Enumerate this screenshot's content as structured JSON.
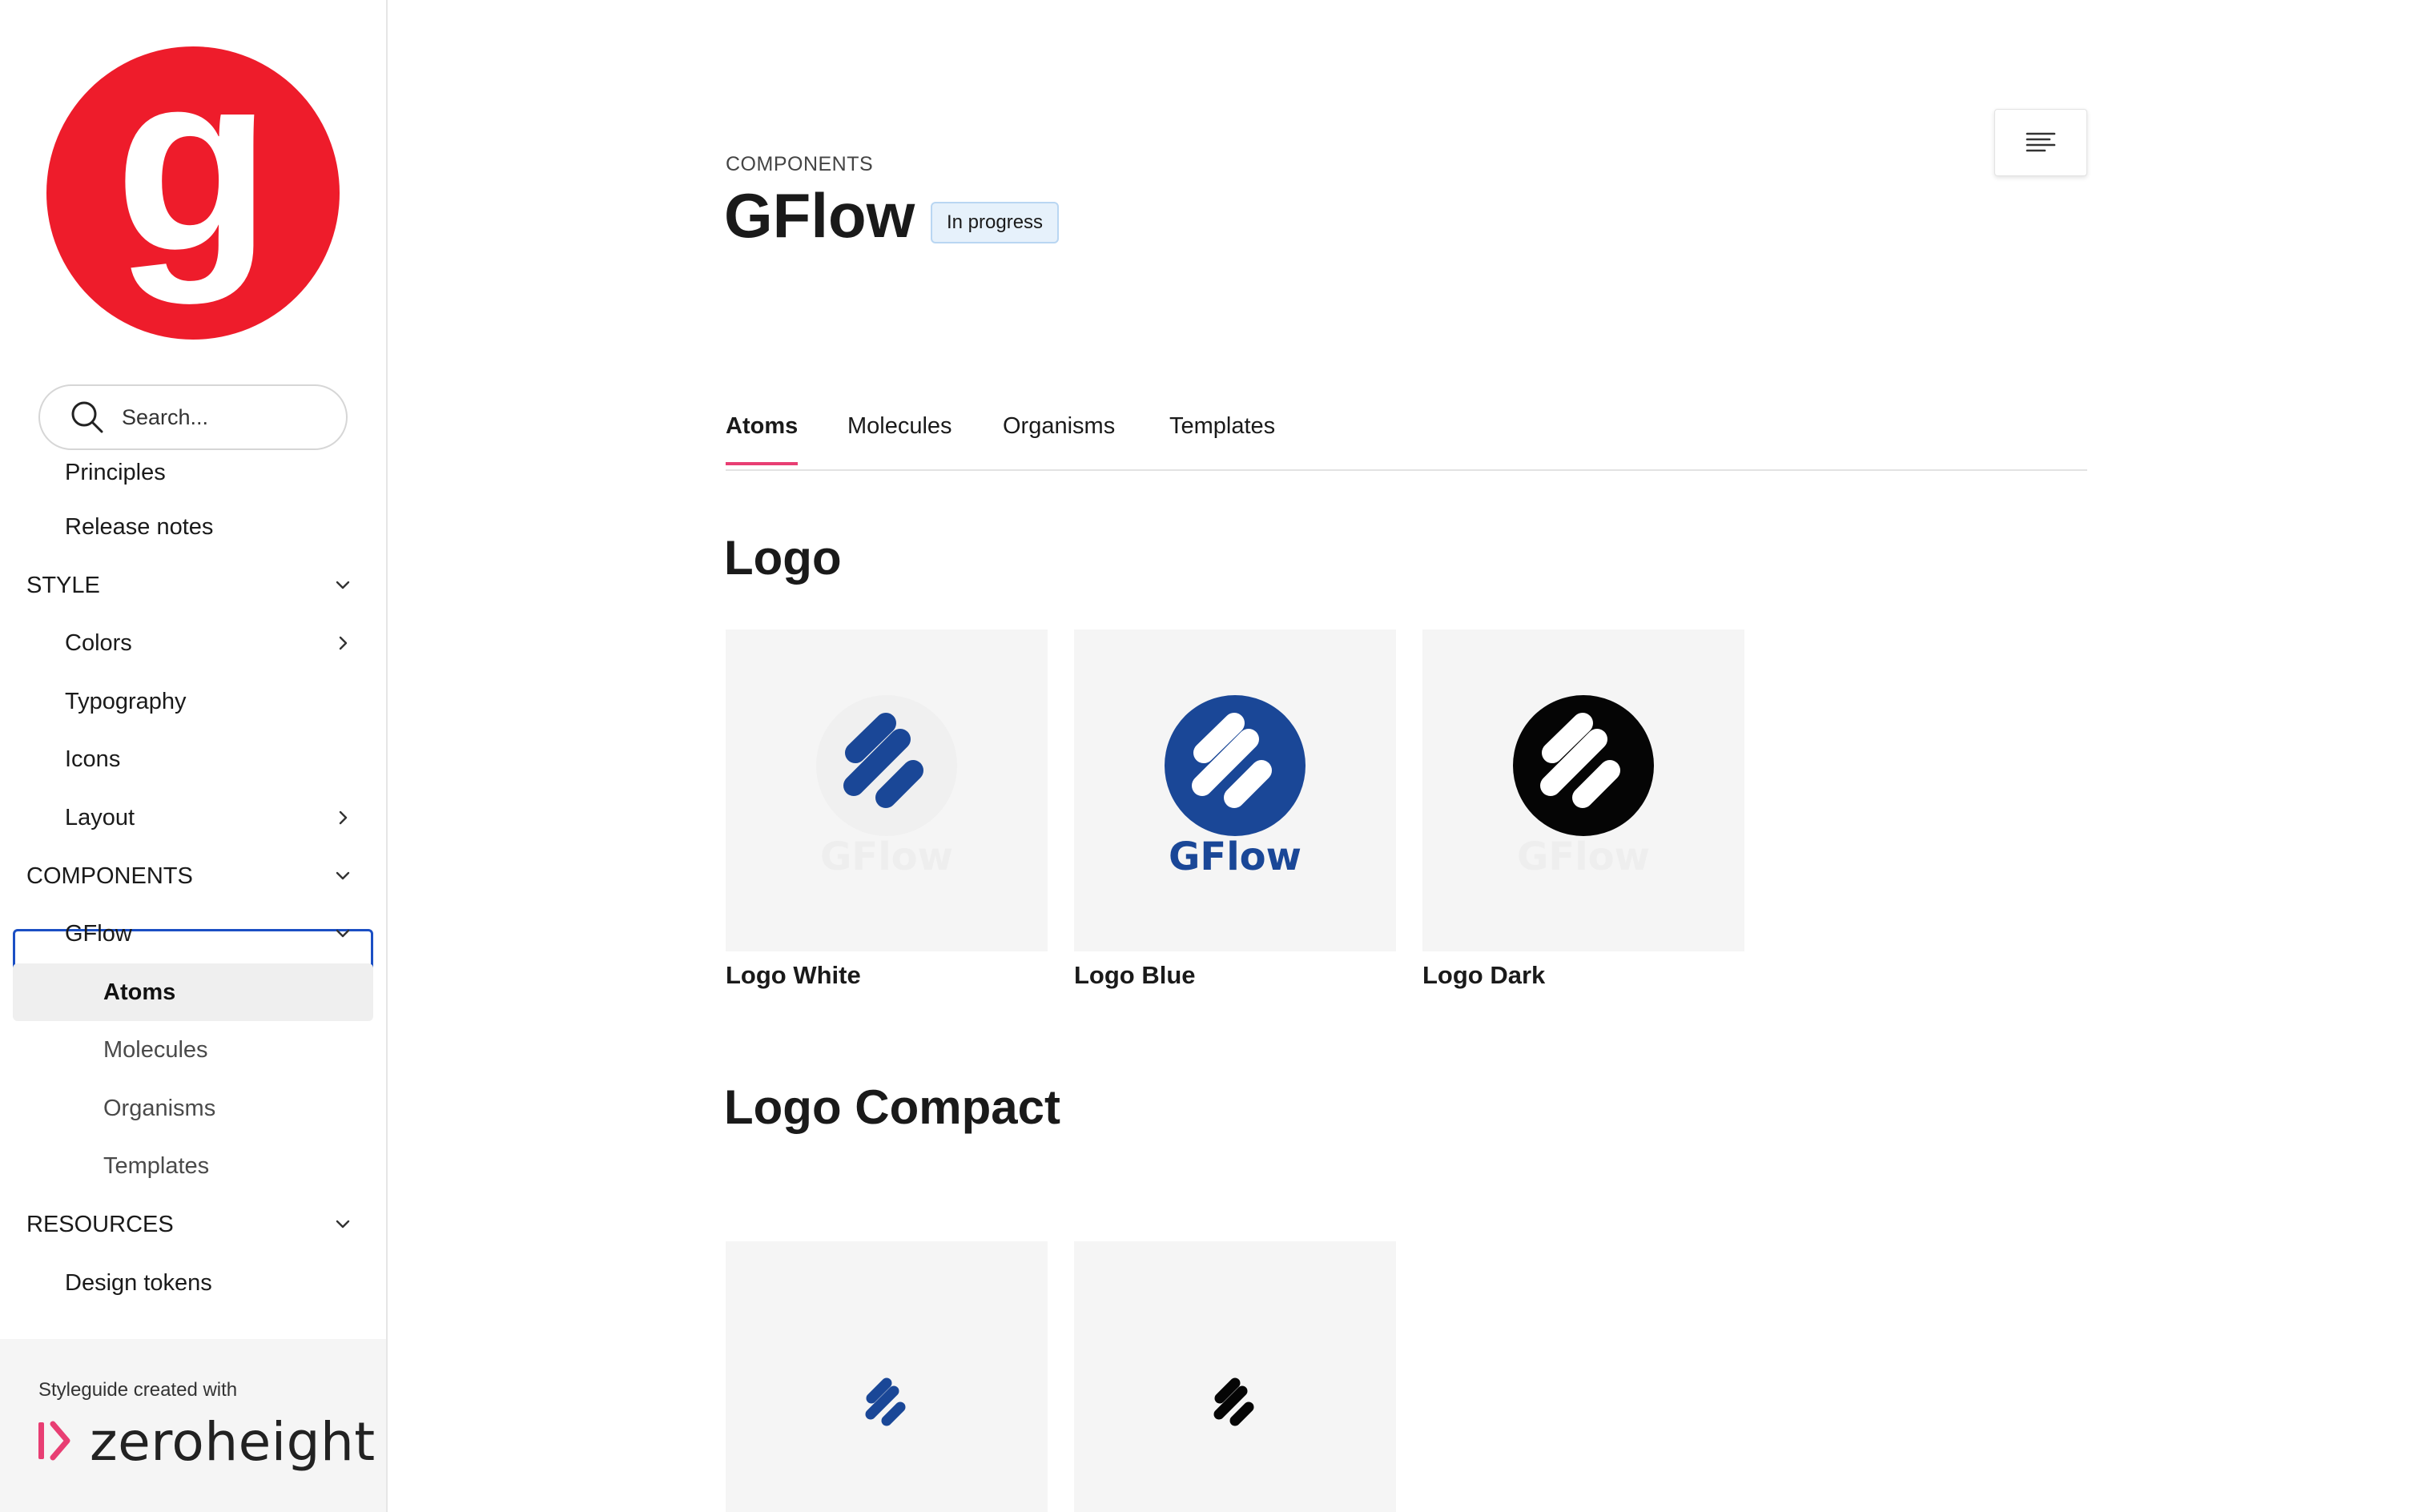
{
  "brand": {
    "logo_letter": "g",
    "logo_color": "#ee1c2b"
  },
  "search": {
    "placeholder": "Search..."
  },
  "sidebar": {
    "items": [
      {
        "label": "Principles"
      },
      {
        "label": "Release notes"
      },
      {
        "label": "STYLE",
        "expanded": true
      },
      {
        "label": "Colors",
        "expandable": true
      },
      {
        "label": "Typography"
      },
      {
        "label": "Icons"
      },
      {
        "label": "Layout",
        "expandable": true
      },
      {
        "label": "COMPONENTS",
        "expanded": true
      },
      {
        "label": "GFlow",
        "expanded": true,
        "focused": true
      },
      {
        "label": "Atoms",
        "selected": true
      },
      {
        "label": "Molecules"
      },
      {
        "label": "Organisms"
      },
      {
        "label": "Templates"
      },
      {
        "label": "RESOURCES",
        "expanded": true
      },
      {
        "label": "Design tokens"
      }
    ]
  },
  "footer": {
    "created_with": "Styleguide created with",
    "brand_name": "zeroheight",
    "brand_color": "#e83e73"
  },
  "page": {
    "eyebrow": "COMPONENTS",
    "title": "GFlow",
    "status": "In progress"
  },
  "tabs": [
    {
      "label": "Atoms",
      "active": true
    },
    {
      "label": "Molecules"
    },
    {
      "label": "Organisms"
    },
    {
      "label": "Templates"
    }
  ],
  "sections": {
    "logo": {
      "title": "Logo",
      "items": [
        {
          "caption": "Logo White",
          "wordmark": "GFlow",
          "variant": "white"
        },
        {
          "caption": "Logo Blue",
          "wordmark": "GFlow",
          "variant": "blue"
        },
        {
          "caption": "Logo Dark",
          "wordmark": "GFlow",
          "variant": "dark"
        }
      ]
    },
    "logo_compact": {
      "title": "Logo Compact",
      "items": [
        {
          "variant": "blue"
        },
        {
          "variant": "dark"
        }
      ]
    }
  },
  "colors": {
    "gflow_blue": "#1a4797",
    "accent_pink": "#e83e73",
    "badge_bg": "#e6f1fb"
  }
}
